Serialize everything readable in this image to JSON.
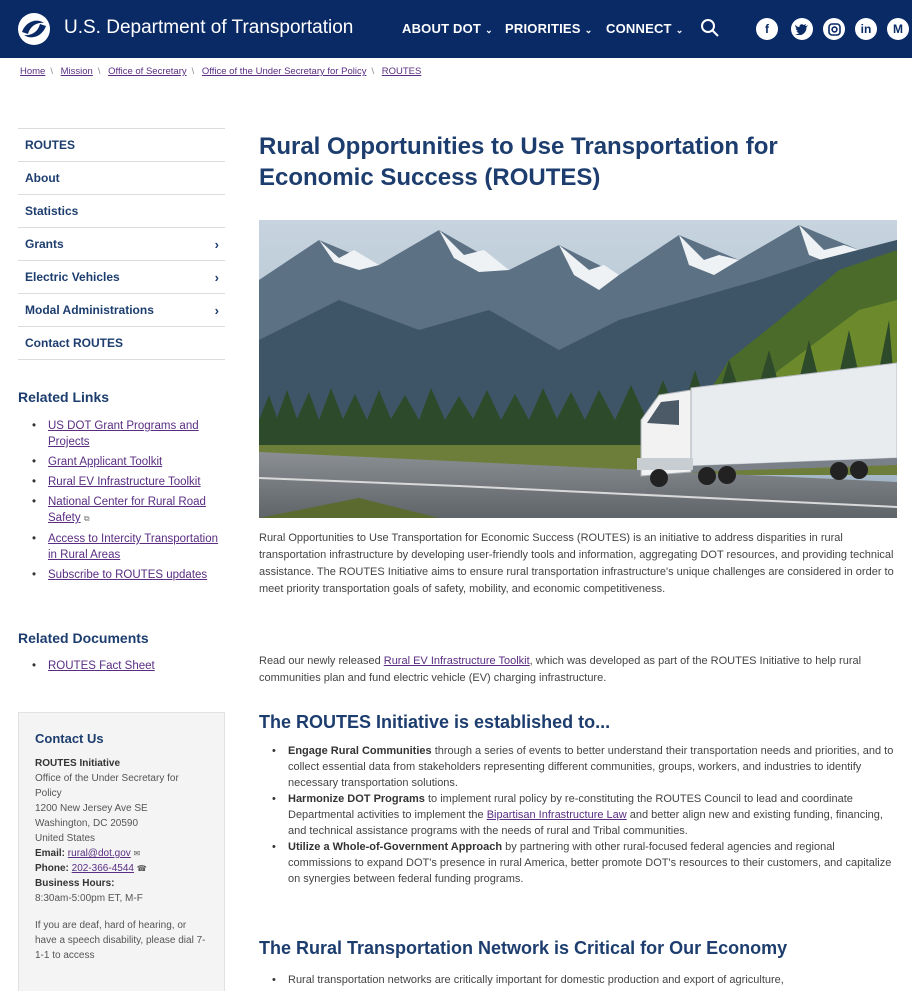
{
  "header": {
    "site_title": "U.S. Department of Transportation",
    "nav": [
      {
        "label": "ABOUT DOT"
      },
      {
        "label": "PRIORITIES"
      },
      {
        "label": "CONNECT"
      }
    ],
    "social": [
      "f",
      "t",
      "ig",
      "in",
      "M"
    ],
    "colors": {
      "bar": "#0a2a66",
      "text": "#ffffff"
    }
  },
  "breadcrumb": [
    "Home",
    "Mission",
    "Office of Secretary",
    "Office of the Under Secretary for Policy",
    "ROUTES"
  ],
  "sidenav": [
    {
      "label": "ROUTES",
      "has_arrow": false
    },
    {
      "label": "About",
      "has_arrow": false
    },
    {
      "label": "Statistics",
      "has_arrow": false
    },
    {
      "label": "Grants",
      "has_arrow": true
    },
    {
      "label": "Electric Vehicles",
      "has_arrow": true
    },
    {
      "label": "Modal Administrations",
      "has_arrow": true
    },
    {
      "label": "Contact ROUTES",
      "has_arrow": false
    }
  ],
  "related_links": {
    "heading": "Related Links",
    "items": [
      "US DOT Grant Programs and Projects",
      "Grant Applicant Toolkit",
      "Rural EV Infrastructure Toolkit",
      "National Center for Rural Road Safety",
      "Access to Intercity Transportation in Rural Areas",
      "Subscribe to ROUTES updates"
    ]
  },
  "related_documents": {
    "heading": "Related Documents",
    "items": [
      "ROUTES Fact Sheet"
    ]
  },
  "contact": {
    "heading": "Contact Us",
    "org": "ROUTES Initiative",
    "office": "Office of the Under Secretary for Policy",
    "street": "1200 New Jersey Ave SE",
    "city": "Washington, DC 20590",
    "country": "United States",
    "email_label": "Email:",
    "email": "rural@dot.gov",
    "phone_label": "Phone:",
    "phone": "202-366-4544",
    "hours_label": "Business Hours:",
    "hours": "8:30am-5:00pm ET, M-F",
    "deaf_note": "If you are deaf, hard of hearing, or have a speech disability, please dial 7-1-1 to access"
  },
  "main": {
    "title": "Rural Opportunities to Use Transportation for Economic Success (ROUTES)",
    "intro": "Rural Opportunities to Use Transportation for Economic Success (ROUTES) is an initiative to address disparities in rural transportation infrastructure by developing user-friendly tools and information, aggregating DOT resources, and providing technical assistance. The ROUTES Initiative aims to ensure rural transportation infrastructure's unique challenges are considered in order to meet priority transportation goals of safety, mobility, and economic competitiveness.",
    "toolkit_pre": "Read our newly released ",
    "toolkit_link": "Rural EV Infrastructure Toolkit",
    "toolkit_post": ", which was developed as part of the ROUTES Initiative to help rural communities plan and fund electric vehicle (EV) charging infrastructure.",
    "section1_heading": "The ROUTES Initiative is established to...",
    "section1_items": [
      {
        "bold": "Engage Rural Communities",
        "text": " through a series of events to better understand their transportation needs and priorities, and to collect essential data from stakeholders representing different communities, groups, workers, and industries to identify necessary transportation solutions."
      },
      {
        "bold": "Harmonize DOT Programs",
        "text_pre": " to implement rural policy by re-constituting the ROUTES Council to lead and coordinate Departmental activities to implement the ",
        "link": "Bipartisan Infrastructure Law",
        "text_post": " and better align new and existing funding, financing, and technical assistance programs with the needs of rural and Tribal communities."
      },
      {
        "bold": "Utilize a Whole-of-Government Approach",
        "text": " by partnering with other rural-focused federal agencies and regional commissions to expand DOT's presence in rural America, better promote DOT's resources to their customers, and capitalize on synergies between federal funding programs."
      }
    ],
    "section2_heading": "The Rural Transportation Network is Critical for Our Economy",
    "section2_items": [
      "Rural transportation networks are critically important for domestic production and export of agriculture,"
    ]
  }
}
